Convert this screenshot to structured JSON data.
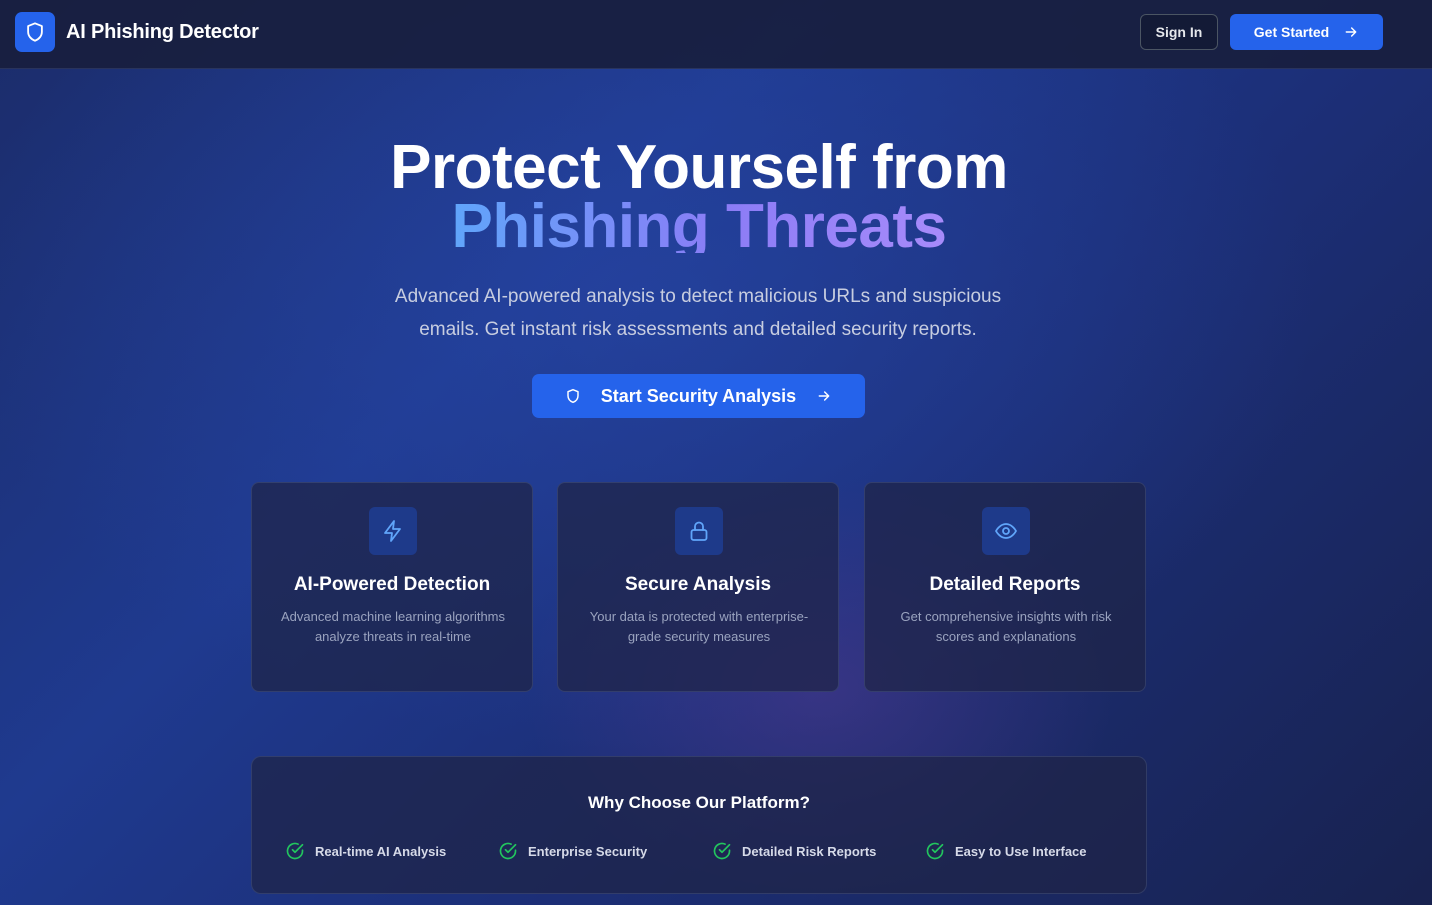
{
  "header": {
    "brand": "AI Phishing Detector",
    "brand_icon": "shield-icon",
    "sign_in_label": "Sign In",
    "get_started_label": "Get Started"
  },
  "hero": {
    "title_line1": "Protect Yourself from",
    "title_line2": "Phishing Threats",
    "subtitle": "Advanced AI-powered analysis to detect malicious URLs and suspicious emails. Get instant risk assessments and detailed security reports.",
    "cta_label": "Start Security Analysis"
  },
  "features": [
    {
      "icon": "lightning-icon",
      "title": "AI-Powered Detection",
      "description": "Advanced machine learning algorithms analyze threats in real-time"
    },
    {
      "icon": "lock-icon",
      "title": "Secure Analysis",
      "description": "Your data is protected with enterprise-grade security measures"
    },
    {
      "icon": "eye-icon",
      "title": "Detailed Reports",
      "description": "Get comprehensive insights with risk scores and explanations"
    }
  ],
  "why": {
    "title": "Why Choose Our Platform?",
    "items": [
      "Real-time AI Analysis",
      "Enterprise Security",
      "Detailed Risk Reports",
      "Easy to Use Interface"
    ]
  },
  "colors": {
    "accent": "#2563eb",
    "check": "#22c55e",
    "gradient_start": "#60a5fa",
    "gradient_end": "#a78bfa"
  }
}
